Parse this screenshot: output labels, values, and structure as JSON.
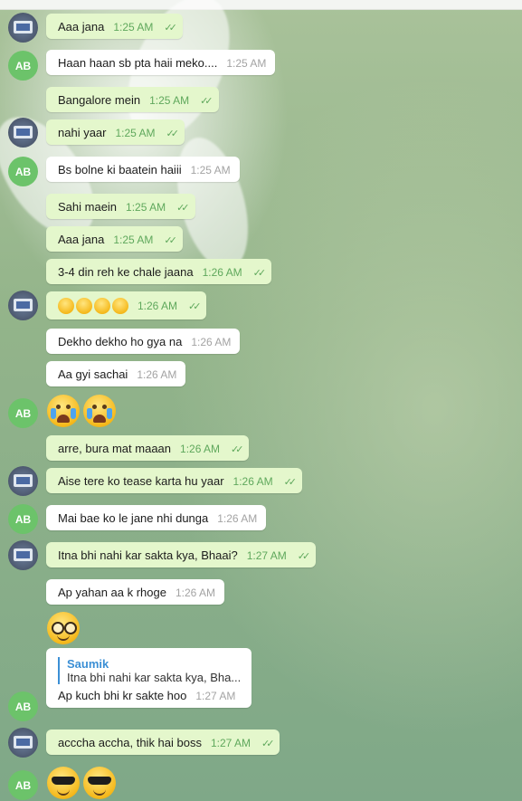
{
  "colors": {
    "outgoing_bubble": "#e4f7cc",
    "incoming_bubble": "#ffffff",
    "read_tick": "#5fa85c",
    "avatar_ab": "#6cc36a",
    "reply_accent": "#3b8fd5"
  },
  "contact_initials": "AB",
  "read_icon": "double-check-icon",
  "messages": [
    {
      "text": "Aaa jana",
      "time": "1:25 AM"
    },
    {
      "text": "Haan haan sb pta haii meko....",
      "time": "1:25 AM"
    },
    {
      "text": "Bangalore mein",
      "time": "1:25 AM"
    },
    {
      "text": "nahi yaar",
      "time": "1:25 AM"
    },
    {
      "text": "Bs bolne ki baatein haiii",
      "time": "1:25 AM"
    },
    {
      "text": "Sahi maein",
      "time": "1:25 AM"
    },
    {
      "text": "Aaa jana",
      "time": "1:25 AM"
    },
    {
      "text": "3-4 din reh ke chale jaana",
      "time": "1:26 AM"
    },
    {
      "emoji": "joy x4",
      "time": "1:26 AM"
    },
    {
      "text": "Dekho dekho ho gya na",
      "time": "1:26 AM"
    },
    {
      "text": "Aa gyi sachai",
      "time": "1:26 AM"
    },
    {
      "emoji": "loudly-crying x2"
    },
    {
      "text": "arre, bura mat maaan",
      "time": "1:26 AM"
    },
    {
      "text": "Aise tere ko tease karta hu yaar",
      "time": "1:26 AM"
    },
    {
      "text": "Mai bae ko le jane nhi dunga",
      "time": "1:26 AM"
    },
    {
      "text": "Itna bhi nahi kar sakta kya, Bhaai?",
      "time": "1:27 AM"
    },
    {
      "text": "Ap yahan aa k rhoge",
      "time": "1:26 AM"
    },
    {
      "emoji": "nerd-face"
    },
    {
      "reply_name": "Saumik",
      "reply_text": "Itna bhi nahi kar sakta kya, Bha...",
      "text": "Ap kuch bhi kr sakte hoo",
      "time": "1:27 AM"
    },
    {
      "text": "acccha accha, thik hai boss",
      "time": "1:27 AM"
    },
    {
      "emoji": "sunglasses x2"
    }
  ]
}
